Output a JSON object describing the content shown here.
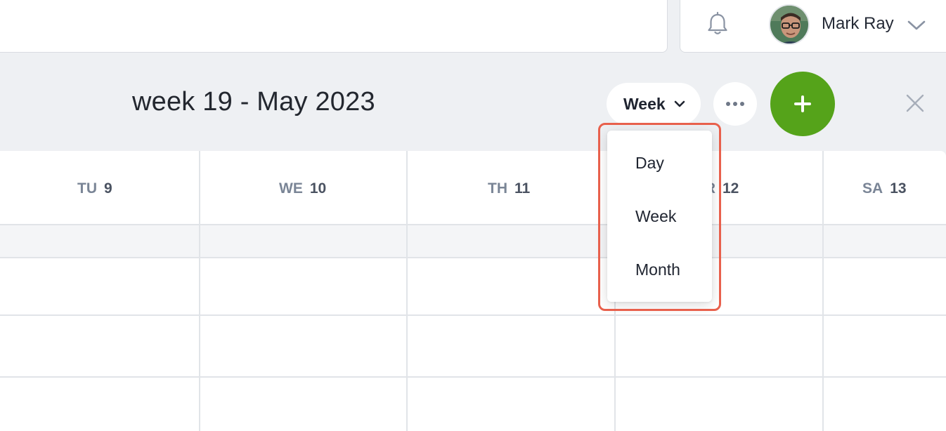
{
  "header": {
    "title": "week 19 - May 2023",
    "view_select_value": "Week",
    "icons": {
      "more": "more-horizontal-icon",
      "add": "plus-icon",
      "close": "close-icon"
    },
    "add_button_color": "#55a31a"
  },
  "user": {
    "name": "Mark Ray",
    "icons": {
      "notifications": "bell-icon",
      "menu": "chevron-down-icon"
    }
  },
  "days": [
    {
      "abbr": "TU",
      "num": "9"
    },
    {
      "abbr": "WE",
      "num": "10"
    },
    {
      "abbr": "TH",
      "num": "11"
    },
    {
      "abbr": "FR",
      "num": "12"
    },
    {
      "abbr": "SA",
      "num": "13"
    }
  ],
  "view_menu": {
    "items": [
      "Day",
      "Week",
      "Month"
    ],
    "highlight_color": "#e8604c"
  }
}
